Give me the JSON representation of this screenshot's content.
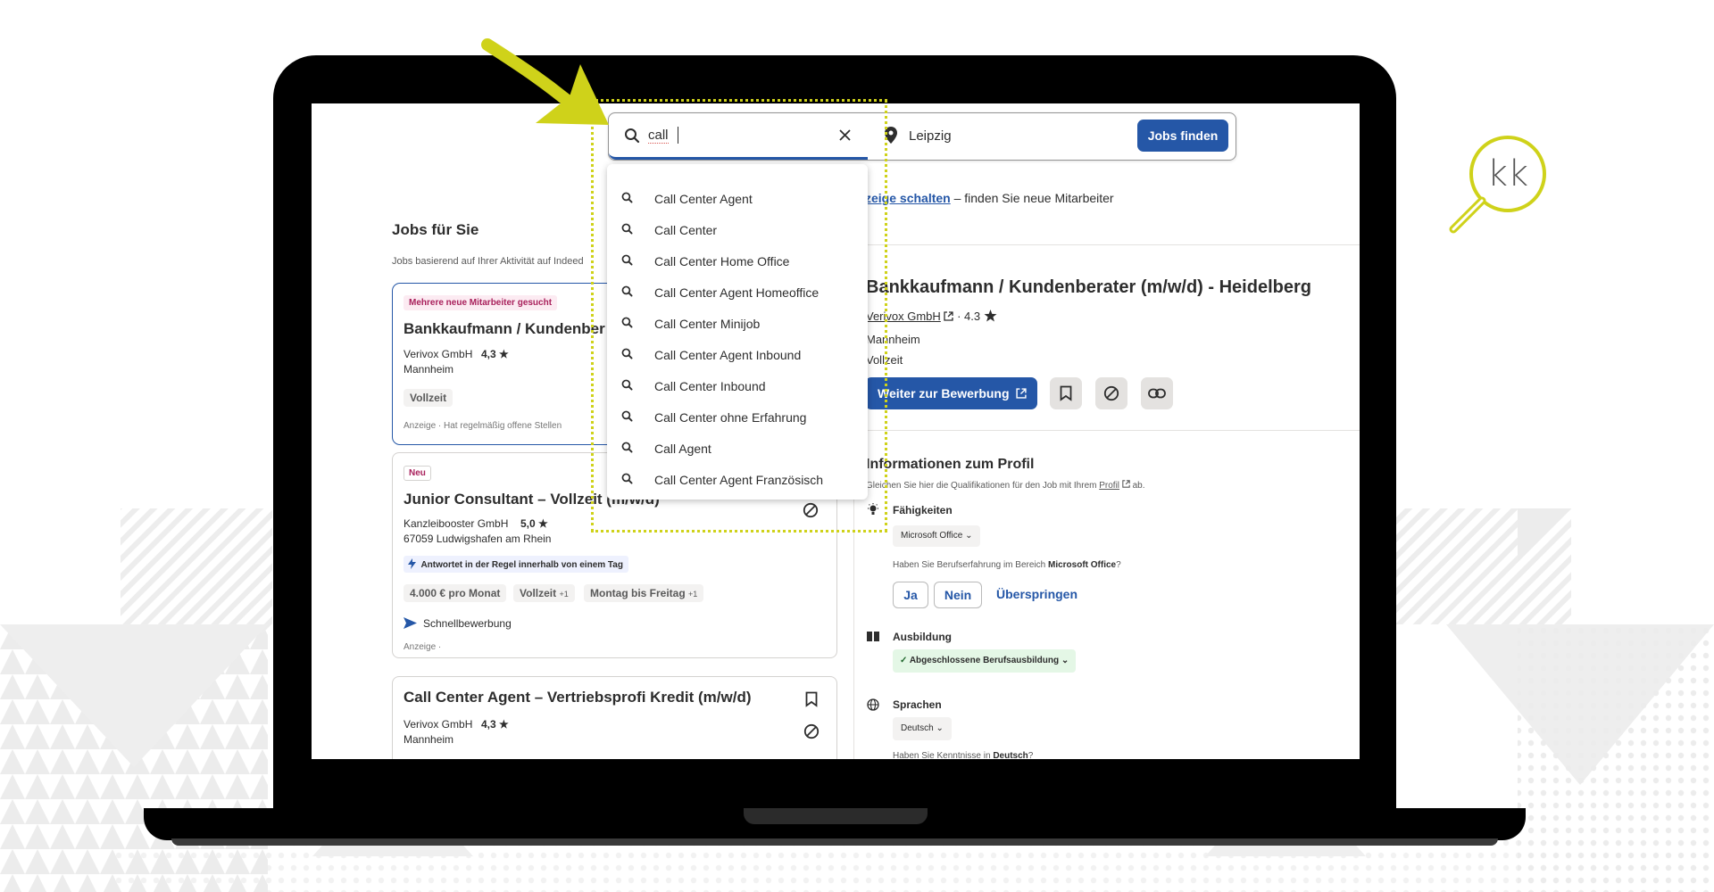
{
  "search": {
    "what_value": "call",
    "where_value": "Leipzig",
    "find_button": "Jobs finden"
  },
  "suggestions": [
    "Call Center Agent",
    "Call Center",
    "Call Center Home Office",
    "Call Center Agent Homeoffice",
    "Call Center Minijob",
    "Call Center Agent Inbound",
    "Call Center Inbound",
    "Call Center ohne Erfahrung",
    "Call Agent",
    "Call Center Agent Französisch"
  ],
  "employer_banner": {
    "link": "zeige schalten",
    "text": "– finden Sie neue Mitarbeiter"
  },
  "left": {
    "heading": "Jobs für Sie",
    "subheading": "Jobs basierend auf Ihrer Aktivität auf Indeed",
    "jobs": [
      {
        "badge": "Mehrere neue Mitarbeiter gesucht",
        "title": "Bankkaufmann / Kundenber",
        "company": "Verivox GmbH",
        "rating": "4,3 ★",
        "location": "Mannheim",
        "tag": "Vollzeit",
        "footer": "Anzeige · Hat regelmäßig offene Stellen"
      },
      {
        "badge": "Neu",
        "title": "Junior Consultant – Vollzeit (m/w/d)",
        "company": "Kanzleibooster GmbH",
        "rating": "5,0 ★",
        "location": "67059 Ludwigshafen am Rhein",
        "response": "Antwortet in der Regel innerhalb von einem Tag",
        "tags": [
          "4.000 € pro Monat",
          "Vollzeit",
          "+1",
          "Montag bis Freitag",
          "+1"
        ],
        "quick_apply": "Schnellbewerbung",
        "footer": "Anzeige ·"
      },
      {
        "title": "Call Center Agent – Vertriebsprofi Kredit (m/w/d)",
        "company": "Verivox GmbH",
        "rating": "4,3 ★",
        "location": "Mannheim"
      }
    ]
  },
  "detail": {
    "title": "Bankkaufmann / Kundenberater (m/w/d) - Heidelberg",
    "company": "Verivox GmbH",
    "rating": "4.3",
    "location": "Mannheim",
    "jobtype": "Vollzeit",
    "apply_button": "Weiter zur Bewerbung",
    "profile_heading": "Informationen zum Profil",
    "profile_sub_pre": "Gleichen Sie hier die Qualifikationen für den Job mit Ihrem",
    "profile_sub_link": "Profil",
    "profile_sub_post": "ab.",
    "skills_label": "Fähigkeiten",
    "skills_chip": "Microsoft Office",
    "question_pre": "Haben Sie Berufserfahrung im Bereich",
    "question_bold": "Microsoft Office",
    "question_post": "?",
    "btn_yes": "Ja",
    "btn_no": "Nein",
    "btn_skip": "Überspringen",
    "education_label": "Ausbildung",
    "education_chip": "Abgeschlossene Berufsausbildung",
    "languages_label": "Sprachen",
    "languages_chip": "Deutsch",
    "languages_question_pre": "Haben Sie Kenntnisse in",
    "languages_question_bold": "Deutsch",
    "languages_question_post": "?"
  },
  "logo": {
    "text": "kk"
  },
  "colors": {
    "accent": "#2557a7",
    "highlight": "#cfd21a",
    "badge_pink": "#a9215c"
  }
}
